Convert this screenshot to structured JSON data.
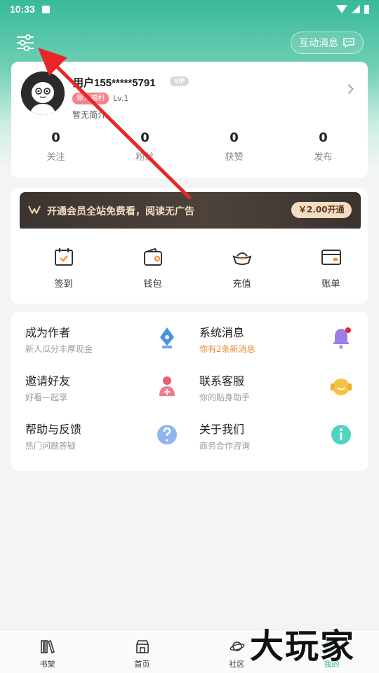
{
  "status_bar": {
    "time": "10:33"
  },
  "header": {
    "message_button_label": "互动消息"
  },
  "profile": {
    "username": "用户155*****5791",
    "vip_badge": "VIP",
    "checkin_badge": "新人福利",
    "level": "Lv.1",
    "bio": "暂无简介",
    "stats": [
      {
        "value": "0",
        "label": "关注"
      },
      {
        "value": "0",
        "label": "粉丝"
      },
      {
        "value": "0",
        "label": "获赞"
      },
      {
        "value": "0",
        "label": "发布"
      }
    ]
  },
  "vip_banner": {
    "text": "开通会员全站免费看，阅读无广告",
    "cta": "￥2.00开通"
  },
  "wallet": {
    "items": [
      {
        "label": "签到",
        "icon": "calendar-check-icon"
      },
      {
        "label": "钱包",
        "icon": "wallet-icon"
      },
      {
        "label": "充值",
        "icon": "ingot-icon"
      },
      {
        "label": "账单",
        "icon": "card-icon"
      }
    ]
  },
  "services": [
    {
      "title": "成为作者",
      "subtitle": "新人瓜分丰厚现金",
      "icon": "pen-nib-icon",
      "highlight": false
    },
    {
      "title": "系统消息",
      "subtitle": "你有2条新消息",
      "icon": "bell-icon",
      "highlight": true
    },
    {
      "title": "邀请好友",
      "subtitle": "好看一起享",
      "icon": "add-person-icon",
      "highlight": false
    },
    {
      "title": "联系客服",
      "subtitle": "你的贴身助手",
      "icon": "headset-icon",
      "highlight": false
    },
    {
      "title": "帮助与反馈",
      "subtitle": "热门问题答疑",
      "icon": "question-icon",
      "highlight": false
    },
    {
      "title": "关于我们",
      "subtitle": "商务合作咨询",
      "icon": "info-icon",
      "highlight": false
    }
  ],
  "bottom_nav": [
    {
      "label": "书架",
      "icon": "bookshelf-icon",
      "active": false
    },
    {
      "label": "首页",
      "icon": "store-icon",
      "active": false
    },
    {
      "label": "社区",
      "icon": "planet-icon",
      "active": false
    },
    {
      "label": "我的",
      "icon": "profile-icon",
      "active": true
    }
  ],
  "watermark": "大玩家",
  "colors": {
    "accent": "#2fb08c",
    "annotation": "#e8262a",
    "highlight_text": "#f08a30"
  }
}
